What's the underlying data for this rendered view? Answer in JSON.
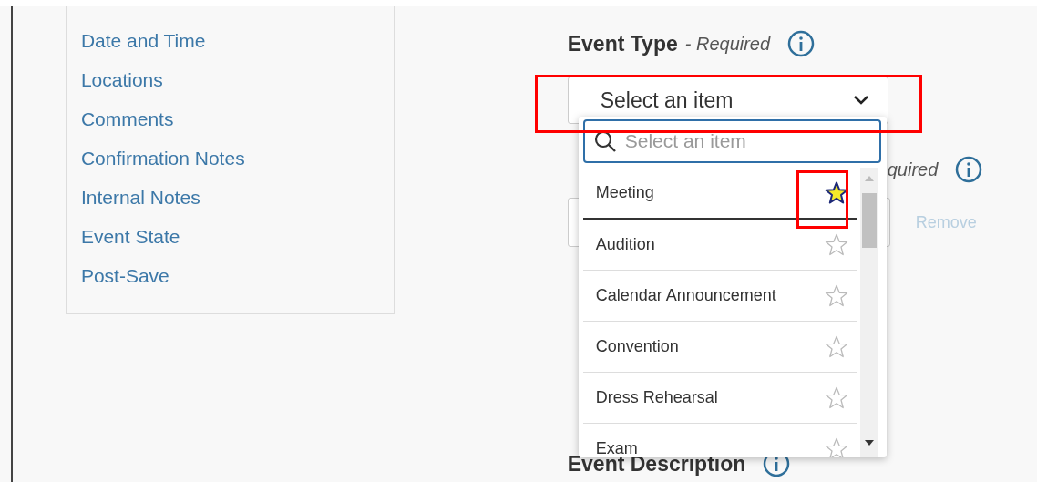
{
  "sidebar": {
    "items": [
      {
        "label": "Date and Time"
      },
      {
        "label": "Locations"
      },
      {
        "label": "Comments"
      },
      {
        "label": "Confirmation Notes"
      },
      {
        "label": "Internal Notes"
      },
      {
        "label": "Event State"
      },
      {
        "label": "Post-Save"
      }
    ]
  },
  "event_type": {
    "label": "Event Type",
    "required": "- Required",
    "select": {
      "value": "Select an item",
      "annotated": true
    }
  },
  "dropdown": {
    "search": {
      "placeholder": "Select an item"
    },
    "options": [
      {
        "label": "Meeting",
        "favorite": true,
        "focused": true,
        "annotated": true
      },
      {
        "label": "Audition",
        "favorite": false,
        "focused": false,
        "annotated": false
      },
      {
        "label": "Calendar Announcement",
        "favorite": false,
        "focused": false,
        "annotated": false
      },
      {
        "label": "Convention",
        "favorite": false,
        "focused": false,
        "annotated": false
      },
      {
        "label": "Dress Rehearsal",
        "favorite": false,
        "focused": false,
        "annotated": false
      },
      {
        "label": "Exam",
        "favorite": false,
        "focused": false,
        "annotated": false
      }
    ]
  },
  "second_field": {
    "label_tail": "quired",
    "remove": "Remove"
  },
  "event_description": {
    "label": "Event Description"
  }
}
